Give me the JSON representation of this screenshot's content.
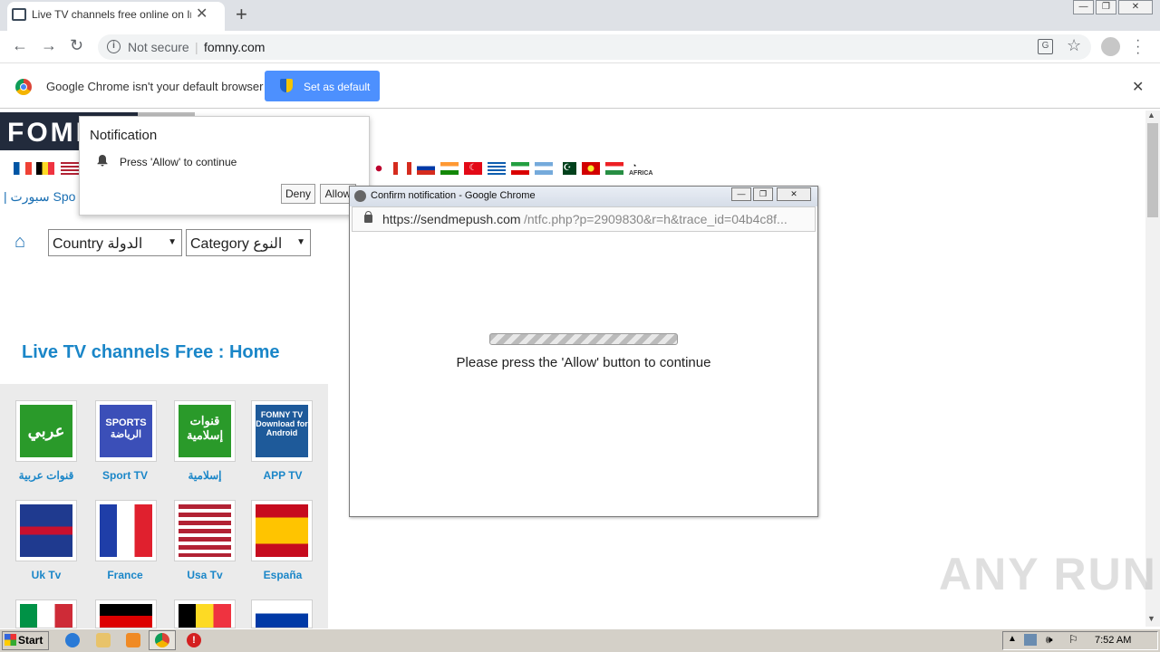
{
  "browser": {
    "tab_title": "Live TV channels free online on Inter",
    "not_secure": "Not secure",
    "url": "fomny.com"
  },
  "infobar": {
    "message": "Google Chrome isn't your default browser",
    "button": "Set as default"
  },
  "page": {
    "logo": "FOMNY",
    "nav_sport": "| سبورت Spo",
    "country_select": "Country الدولة",
    "category_select": "Category النوع",
    "heading": "Live TV channels Free : Home",
    "africa_label": "AFRICA",
    "tiles": [
      {
        "label": "قنوات عربية",
        "art": "عربي",
        "color": "#2a9a2a"
      },
      {
        "label": "Sport TV",
        "art": "SPORTS الرياضة",
        "color": "#3b4fb8"
      },
      {
        "label": "إسلامية",
        "art": "قنوات إسلامية",
        "color": "#2a9a2a"
      },
      {
        "label": "APP TV",
        "art": "FOMNY TV Download for Android",
        "color": "#1e5a9a"
      },
      {
        "label": "Uk Tv",
        "color": "#1f3a8f"
      },
      {
        "label": "France",
        "color": "#1f3ea8"
      },
      {
        "label": "Usa Tv",
        "color": "#b22234"
      },
      {
        "label": "España",
        "color": "#c60b1e"
      }
    ]
  },
  "notification": {
    "title": "Notification",
    "message": "Press 'Allow' to continue",
    "deny": "Deny",
    "allow": "Allow"
  },
  "popup": {
    "title": "Confirm notification - Google Chrome",
    "url_host": "https://sendmepush.com",
    "url_rest": "/ntfc.php?p=2909830&r=h&trace_id=04b4c8f...",
    "message": "Please press the 'Allow' button to continue"
  },
  "watermark": "ANY RUN",
  "taskbar": {
    "start": "Start",
    "clock": "7:52 AM"
  }
}
